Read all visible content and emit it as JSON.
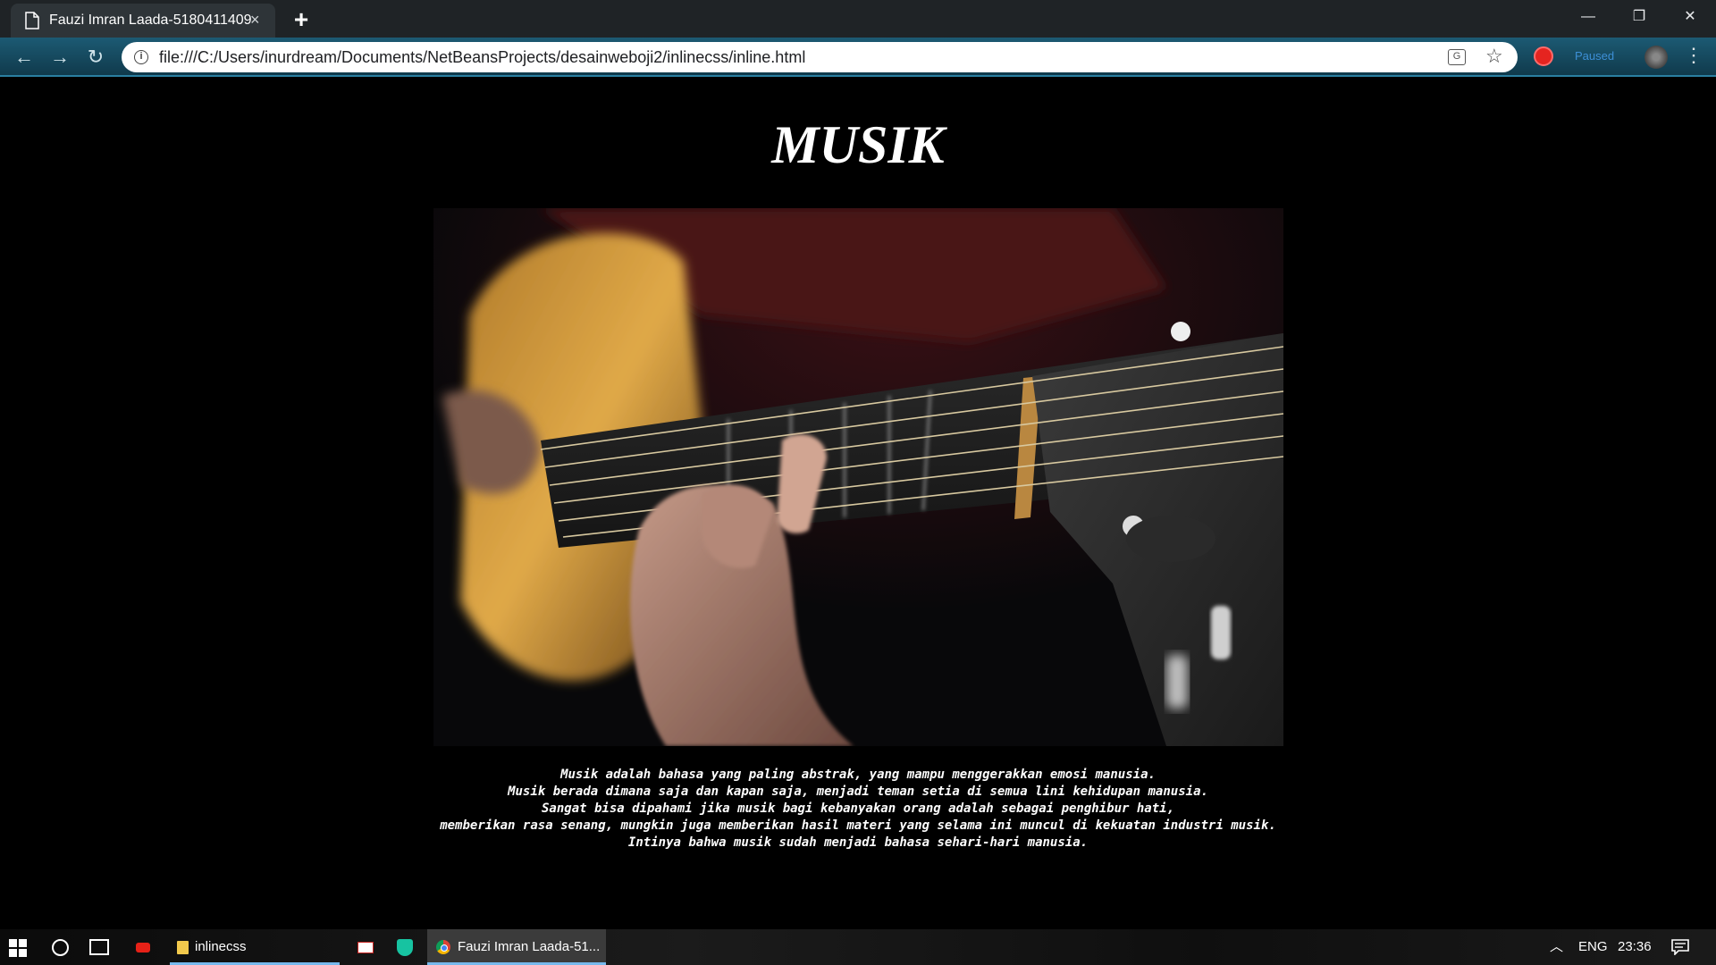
{
  "browser": {
    "tab_title": "Fauzi Imran Laada-5180411409",
    "tab_close": "×",
    "new_tab": "+",
    "url": "file:///C:/Users/inurdream/Documents/NetBeansProjects/desainweboji2/inlinecss/inline.html",
    "profile_status": "Paused",
    "window_controls": {
      "minimize": "—",
      "restore": "❐",
      "close": "✕"
    },
    "icons": [
      "back-icon",
      "forward-icon",
      "reload-icon",
      "info-icon",
      "translate-icon",
      "star-icon",
      "extension-icon",
      "avatar",
      "menu-icon"
    ]
  },
  "page": {
    "title": "MUSIK",
    "image_alt": "guitar",
    "paragraph": [
      "Musik adalah bahasa yang paling abstrak, yang mampu menggerakkan emosi manusia.",
      "Musik berada dimana saja dan kapan saja, menjadi teman setia di semua lini kehidupan manusia.",
      "Sangat bisa dipahami jika musik bagi kebanyakan orang adalah sebagai penghibur hati,",
      "memberikan rasa senang, mungkin juga memberikan hasil materi yang selama ini muncul di kekuatan industri musik.",
      "Intinya bahwa musik sudah menjadi bahasa sehari-hari manusia."
    ],
    "background_color": "#000000",
    "text_color": "#ffffff"
  },
  "taskbar": {
    "explorer_label": "inlinecss",
    "chrome_label": "Fauzi Imran Laada-51...",
    "language": "ENG",
    "time": "23:36",
    "icons": [
      "windows-start-icon",
      "cortana-icon",
      "task-view-icon",
      "youtube-icon",
      "folder-icon",
      "mail-icon",
      "shield-icon",
      "chrome-icon",
      "tray-chevron-icon",
      "notification-icon"
    ]
  }
}
